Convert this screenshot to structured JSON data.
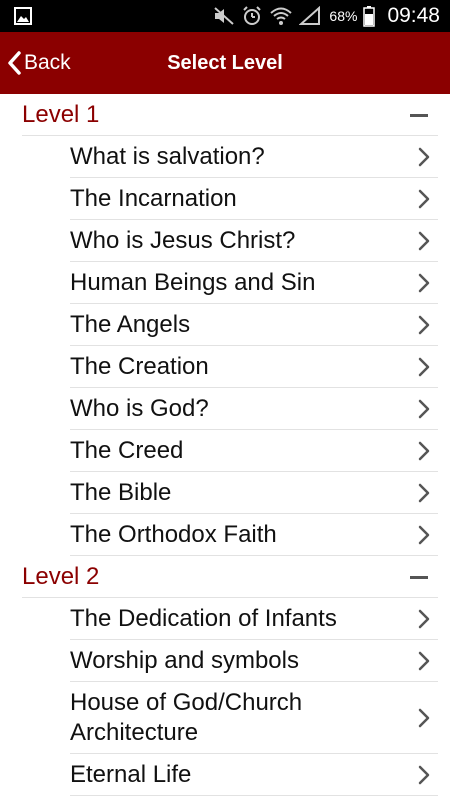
{
  "status_bar": {
    "battery": "68%",
    "time": "09:48"
  },
  "app_bar": {
    "back_label": "Back",
    "title": "Select Level"
  },
  "colors": {
    "brand": "#8b0000",
    "divider": "#e2e2e2"
  },
  "sections": [
    {
      "title": "Level 1",
      "items": [
        "What is salvation?",
        "The Incarnation",
        "Who is Jesus Christ?",
        "Human Beings and Sin",
        "The Angels",
        "The Creation",
        "Who is God?",
        "The Creed",
        "The Bible",
        "The Orthodox Faith"
      ]
    },
    {
      "title": "Level 2",
      "items": [
        "The Dedication of Infants",
        "Worship and symbols",
        "House of God/Church Architecture",
        "Eternal Life"
      ]
    }
  ]
}
